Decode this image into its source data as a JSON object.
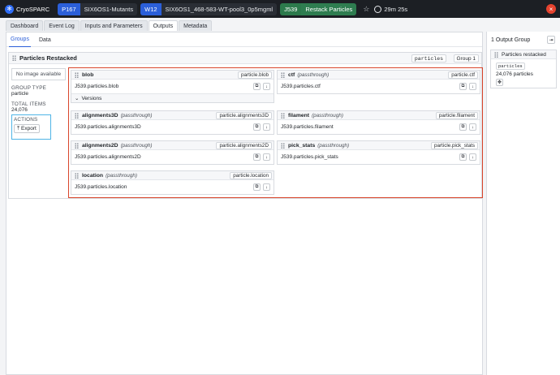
{
  "app": {
    "name": "CryoSPARC"
  },
  "breadcrumbs": [
    {
      "tag": "P167",
      "label": "SIX6OS1-Mutants"
    },
    {
      "tag": "W12",
      "label": "SIX6OS1_468-583-WT-pool3_0p5mgml"
    },
    {
      "tag": "J539",
      "label": "Restack Particles"
    }
  ],
  "timer": "29m 25s",
  "tabs": [
    "Dashboard",
    "Event Log",
    "Inputs and Parameters",
    "Outputs",
    "Metadata"
  ],
  "subtabs": [
    "Groups",
    "Data"
  ],
  "group": {
    "title": "Particles Restacked",
    "type_pill": "particles",
    "index_pill": "Group 1",
    "no_image": "No image available",
    "group_type_label": "GROUP TYPE",
    "group_type_value": "particle",
    "total_items_label": "TOTAL ITEMS",
    "total_items_value": "24,076",
    "actions_label": "ACTIONS",
    "export_label": "Export"
  },
  "fields": [
    {
      "name": "blob",
      "pass": "",
      "tag": "particle.blob",
      "path": "J539.particles.blob"
    },
    {
      "name": "ctf",
      "pass": "(passthrough)",
      "tag": "particle.ctf",
      "path": "J539.particles.ctf"
    },
    {
      "name": "alignments3D",
      "pass": "(passthrough)",
      "tag": "particle.alignments3D",
      "path": "J539.particles.alignments3D"
    },
    {
      "name": "filament",
      "pass": "(passthrough)",
      "tag": "particle.filament",
      "path": "J539.particles.filament"
    },
    {
      "name": "alignments2D",
      "pass": "(passthrough)",
      "tag": "particle.alignments2D",
      "path": "J539.particles.alignments2D"
    },
    {
      "name": "pick_stats",
      "pass": "(passthrough)",
      "tag": "particle.pick_stats",
      "path": "J539.particles.pick_stats"
    },
    {
      "name": "location",
      "pass": "(passthrough)",
      "tag": "particle.location",
      "path": "J539.particles.location"
    }
  ],
  "versions_label": "Versions",
  "right_panel": {
    "title": "1 Output Group",
    "card_title": "Particles restacked",
    "pill": "particles",
    "count": "24,076 particles"
  }
}
